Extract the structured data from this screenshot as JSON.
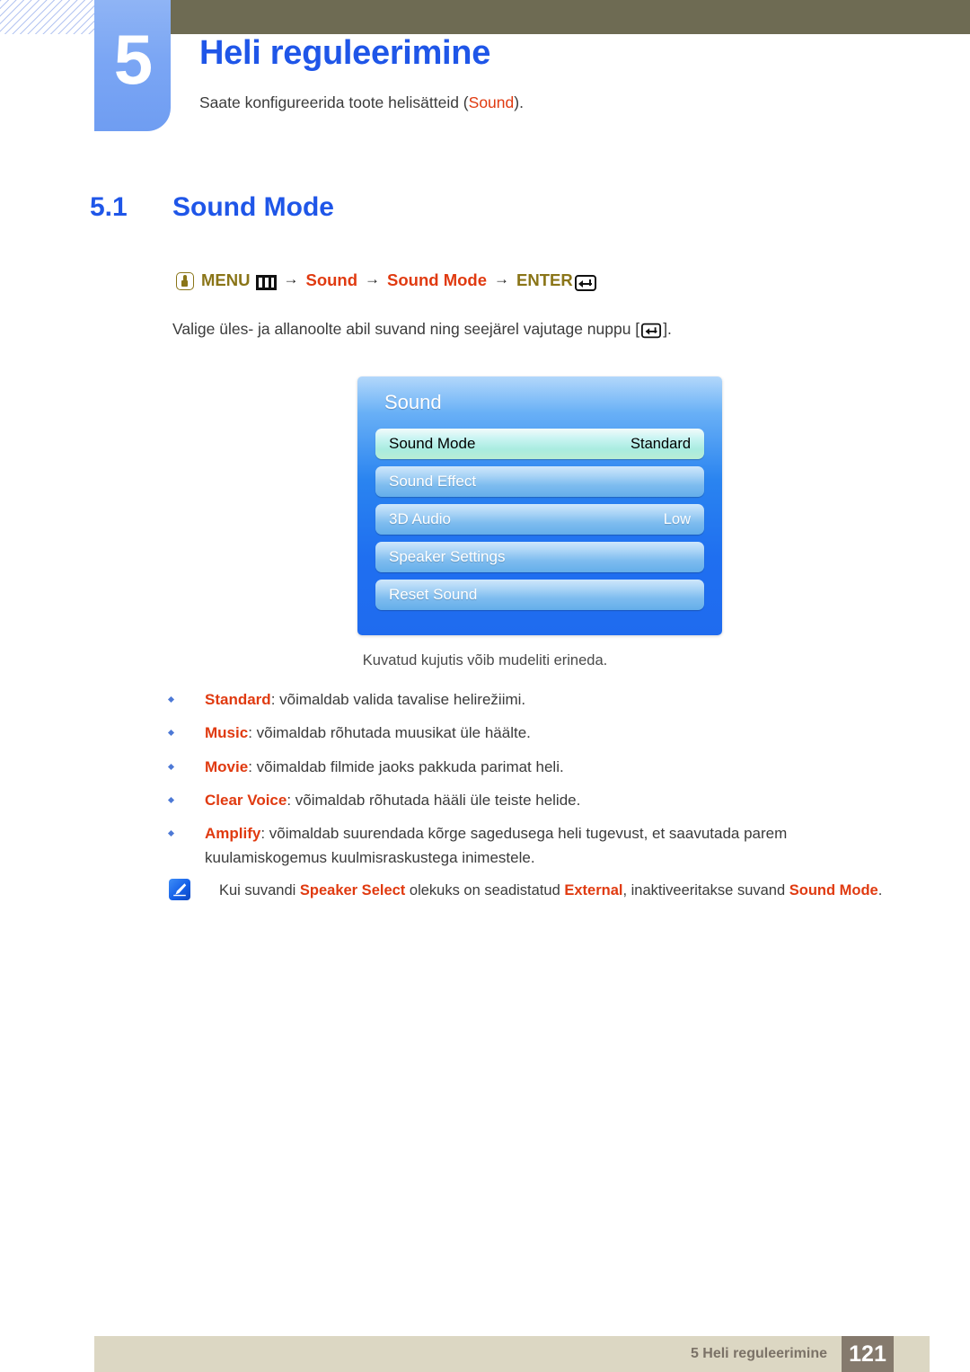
{
  "header": {
    "chapter_number": "5",
    "chapter_title": "Heli reguleerimine",
    "chapter_desc_before": "Saate konfigureerida toote helisätteid (",
    "chapter_desc_keyword": "Sound",
    "chapter_desc_after": ")."
  },
  "section": {
    "number": "5.1",
    "title": "Sound Mode"
  },
  "menu_path": {
    "hand_icon": "hand-press-icon",
    "menu_label": "MENU",
    "menu_icon": "menu-bars-icon",
    "arrow": "→",
    "step1": "Sound",
    "step2": "Sound Mode",
    "enter_label": "ENTER",
    "enter_icon": "enter-key-icon"
  },
  "instruction": {
    "before": "Valige üles- ja allanoolte abil suvand ning seejärel vajutage nuppu [",
    "after": "]."
  },
  "osd": {
    "title": "Sound",
    "rows": [
      {
        "label": "Sound Mode",
        "value": "Standard",
        "selected": true
      },
      {
        "label": "Sound Effect",
        "value": "",
        "selected": false
      },
      {
        "label": "3D Audio",
        "value": "Low",
        "selected": false
      },
      {
        "label": "Speaker Settings",
        "value": "",
        "selected": false
      },
      {
        "label": "Reset Sound",
        "value": "",
        "selected": false
      }
    ],
    "caption": "Kuvatud kujutis võib mudeliti erineda."
  },
  "bullets": [
    {
      "term": "Standard",
      "text": ": võimaldab valida tavalise helirežiimi."
    },
    {
      "term": "Music",
      "text": ": võimaldab rõhutada muusikat üle häälte."
    },
    {
      "term": "Movie",
      "text": ": võimaldab filmide jaoks pakkuda parimat heli."
    },
    {
      "term": "Clear Voice",
      "text": ": võimaldab rõhutada hääli üle teiste helide."
    },
    {
      "term": "Amplify",
      "text": ": võimaldab suurendada kõrge sagedusega heli tugevust, et saavutada parem kuulamiskogemus kuulmisraskustega inimestele."
    }
  ],
  "note": {
    "icon": "note-pen-icon",
    "part1": "Kui suvandi ",
    "kw1": "Speaker Select",
    "part2": " olekuks on seadistatud ",
    "kw2": "External",
    "part3": ", inaktiveeritakse suvand ",
    "kw3": "Sound Mode",
    "part4": "."
  },
  "footer": {
    "text": "5 Heli reguleerimine",
    "page": "121"
  },
  "colors": {
    "accent_blue": "#1f56e8",
    "keyword_red": "#e03a10",
    "menu_olive": "#8a7518",
    "top_bar": "#6e6b53",
    "footer_band": "#dcd7c3",
    "page_box": "#857a6d"
  }
}
